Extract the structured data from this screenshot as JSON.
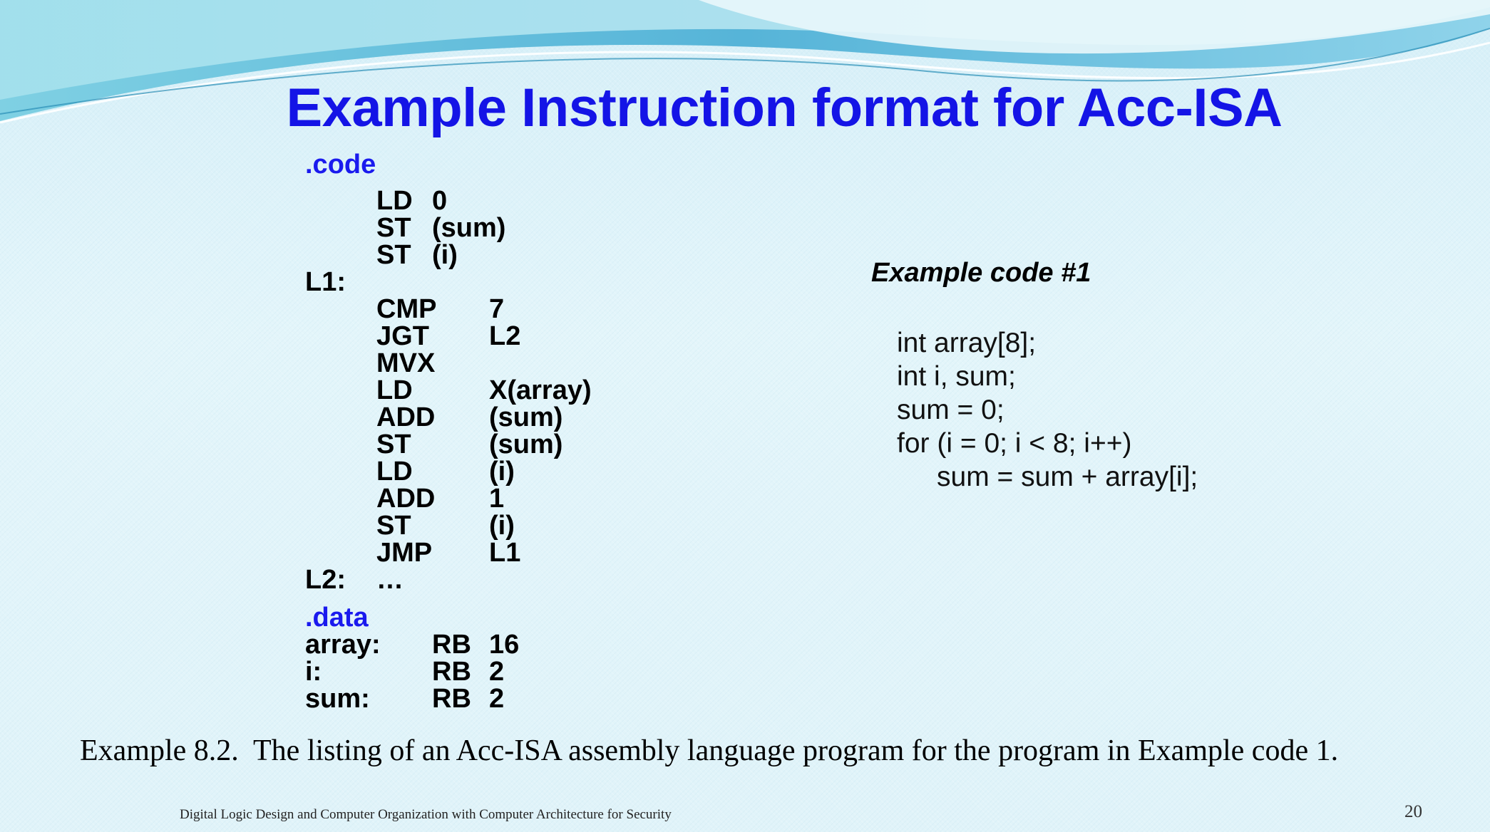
{
  "slide": {
    "title": "Example Instruction format for Acc-ISA",
    "code_section": {
      "directive": ".code",
      "lines": [
        {
          "label": "",
          "op": "LD",
          "arg": "0"
        },
        {
          "label": "",
          "op": "ST",
          "arg": "(sum)"
        },
        {
          "label": "",
          "op": "ST",
          "arg": "(i)"
        },
        {
          "label": "L1:",
          "op": "",
          "arg": ""
        },
        {
          "label": "",
          "op": "CMP",
          "arg": "7"
        },
        {
          "label": "",
          "op": "JGT",
          "arg": "L2"
        },
        {
          "label": "",
          "op": "MVX",
          "arg": ""
        },
        {
          "label": "",
          "op": "LD",
          "arg": "X(array)"
        },
        {
          "label": "",
          "op": "ADD",
          "arg": "(sum)"
        },
        {
          "label": "",
          "op": "ST",
          "arg": "(sum)"
        },
        {
          "label": "",
          "op": "LD",
          "arg": "(i)"
        },
        {
          "label": "",
          "op": "ADD",
          "arg": "1"
        },
        {
          "label": "",
          "op": "ST",
          "arg": "(i)"
        },
        {
          "label": "",
          "op": "JMP",
          "arg": "L1"
        },
        {
          "label": "L2:",
          "op": "…",
          "arg": ""
        }
      ]
    },
    "data_section": {
      "directive": ".data",
      "lines": [
        {
          "label": "array:",
          "op": "RB",
          "arg": "16"
        },
        {
          "label": "i:",
          "op": "RB",
          "arg": "2"
        },
        {
          "label": "sum:",
          "op": "RB",
          "arg": "2"
        }
      ]
    },
    "example": {
      "heading": "Example code #1",
      "lines": [
        "int array[8];",
        "int i, sum;",
        "sum = 0;",
        "for (i = 0; i < 8; i++)",
        "sum = sum + array[i];"
      ]
    },
    "caption": "Example 8.2.  The listing of an Acc-ISA assembly language program for the program in Example code 1.",
    "footer": "Digital Logic Design and Computer Organization with Computer Architecture for Security",
    "page_number": "20",
    "colors": {
      "title": "#1414e6",
      "directive": "#1a1aee",
      "background": "#dff3f9"
    }
  }
}
